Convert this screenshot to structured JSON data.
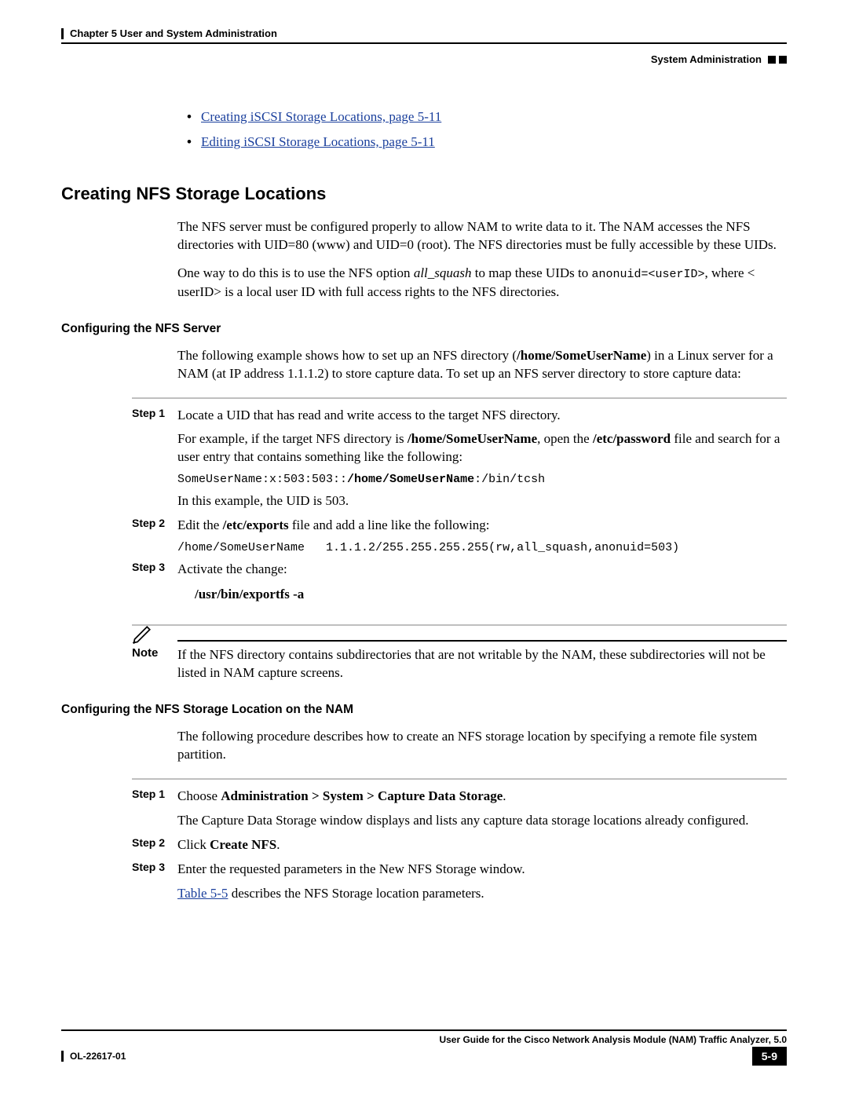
{
  "header": {
    "chapter": "Chapter 5    User and System Administration",
    "section": "System Administration"
  },
  "bullets": [
    "Creating iSCSI Storage Locations, page 5-11",
    "Editing iSCSI Storage Locations, page 5-11"
  ],
  "h2": "Creating NFS Storage Locations",
  "intro1_a": "The NFS server must be configured properly to allow NAM to write data to it. The NAM accesses the NFS directories with UID=80 (www) and UID=0 (root). The NFS directories must be fully accessible by these UIDs.",
  "intro2_pre": "One way to do this is to use the NFS option ",
  "intro2_em": "all_squash",
  "intro2_mid": " to map these UIDs to ",
  "intro2_code": "anonuid=<userID>",
  "intro2_post": ", where < userID> is a local user ID with full access rights to the NFS directories.",
  "h3a": "Configuring the NFS Server",
  "cfg_intro_a": "The following example shows how to set up an NFS directory (",
  "cfg_intro_b": "/home/SomeUserName",
  "cfg_intro_c": ") in a Linux server for a NAM (at IP address 1.1.1.2) to store capture data. To set up an NFS server directory to store capture data:",
  "stepsA": {
    "s1_label": "Step 1",
    "s1_body": "Locate a UID that has read and write access to the target NFS directory.",
    "s1_f1_a": "For example, if the target NFS directory is ",
    "s1_f1_b": "/home/SomeUserName",
    "s1_f1_c": ", open the ",
    "s1_f1_d": "/etc/password",
    "s1_f1_e": " file and search for a user entry that contains something like the following:",
    "s1_code_a": "SomeUserName:x:503:503::",
    "s1_code_b": "/home/SomeUserName",
    "s1_code_c": ":/bin/tcsh",
    "s1_f2": "In this example, the UID is 503.",
    "s2_label": "Step 2",
    "s2_body_a": "Edit the ",
    "s2_body_b": "/etc/exports",
    "s2_body_c": " file and add a line like the following:",
    "s2_code": "/home/SomeUserName   1.1.1.2/255.255.255.255(rw,all_squash,anonuid=503)",
    "s3_label": "Step 3",
    "s3_body": "Activate the change:",
    "s3_cmd": "/usr/bin/exportfs -a"
  },
  "note_label": "Note",
  "note_text": "If the NFS directory contains subdirectories that are not writable by the NAM, these subdirectories will not be listed in NAM capture screens.",
  "h3b": "Configuring the NFS Storage Location on the NAM",
  "cfgB_intro": "The following procedure describes how to create an NFS storage location by specifying a remote file system partition.",
  "stepsB": {
    "s1_label": "Step 1",
    "s1_a": "Choose ",
    "s1_b": "Administration > System > Capture Data Storage",
    "s1_c": ".",
    "s1_f": "The Capture Data Storage window displays and lists any capture data storage locations already configured.",
    "s2_label": "Step 2",
    "s2_a": "Click ",
    "s2_b": "Create NFS",
    "s2_c": ".",
    "s3_label": "Step 3",
    "s3": "Enter the requested parameters in the New NFS Storage window.",
    "s3_f_a": "Table 5-5",
    "s3_f_b": " describes the NFS Storage location parameters."
  },
  "footer": {
    "guide": "User Guide for the Cisco Network Analysis Module (NAM) Traffic Analyzer, 5.0",
    "doc": "OL-22617-01",
    "page": "5-9"
  }
}
